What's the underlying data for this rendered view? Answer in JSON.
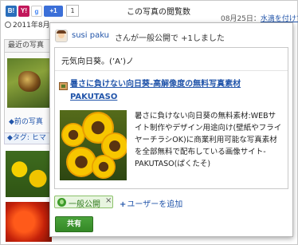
{
  "background": {
    "social_buttons": {
      "hatena": "B!",
      "yahoo": "Y!",
      "google": "g",
      "plusone": "+1",
      "plusone_count": "1"
    },
    "views_label": "この写真の閲覧数",
    "date_right": "08月25日：",
    "date_right_link": "水滴を付けて",
    "date_left": "2011年8月",
    "recent_photos_tab": "最近の写真",
    "prev_link": "◆前の写真",
    "tag_label": "◆タグ: ヒマ"
  },
  "share_dialog": {
    "user_name": "susi paku",
    "action_text": "さんが一般公開で +1しました",
    "comment": "元気向日葵。(’A’)ノ",
    "link": {
      "title": "暑さに負けない向日葵-高解像度の無料写真素材PAKUTASO",
      "description": "暑さに負けない向日葵の無料素材:WEBサイト制作やデザイン用途向け(壁紙やフライヤーチラシOK)に商業利用可能な写真素材を全部無料で配布している画像サイト-PAKUTASO(ぱくたそ)"
    },
    "audience": {
      "public_label": "一般公開",
      "remove_symbol": "×",
      "add_users": "ユーザーを追加"
    },
    "share_button": "共有"
  },
  "colors": {
    "link_blue": "#2255aa",
    "share_green": "#348826",
    "chip_green_bg": "#e8f5e0"
  },
  "icons": [
    "hatena-bookmark-icon",
    "yahoo-bookmark-icon",
    "google-bookmark-icon",
    "plusone-icon",
    "clock-icon",
    "avatar",
    "link-favicon",
    "globe-icon",
    "close-icon",
    "plus-icon"
  ]
}
